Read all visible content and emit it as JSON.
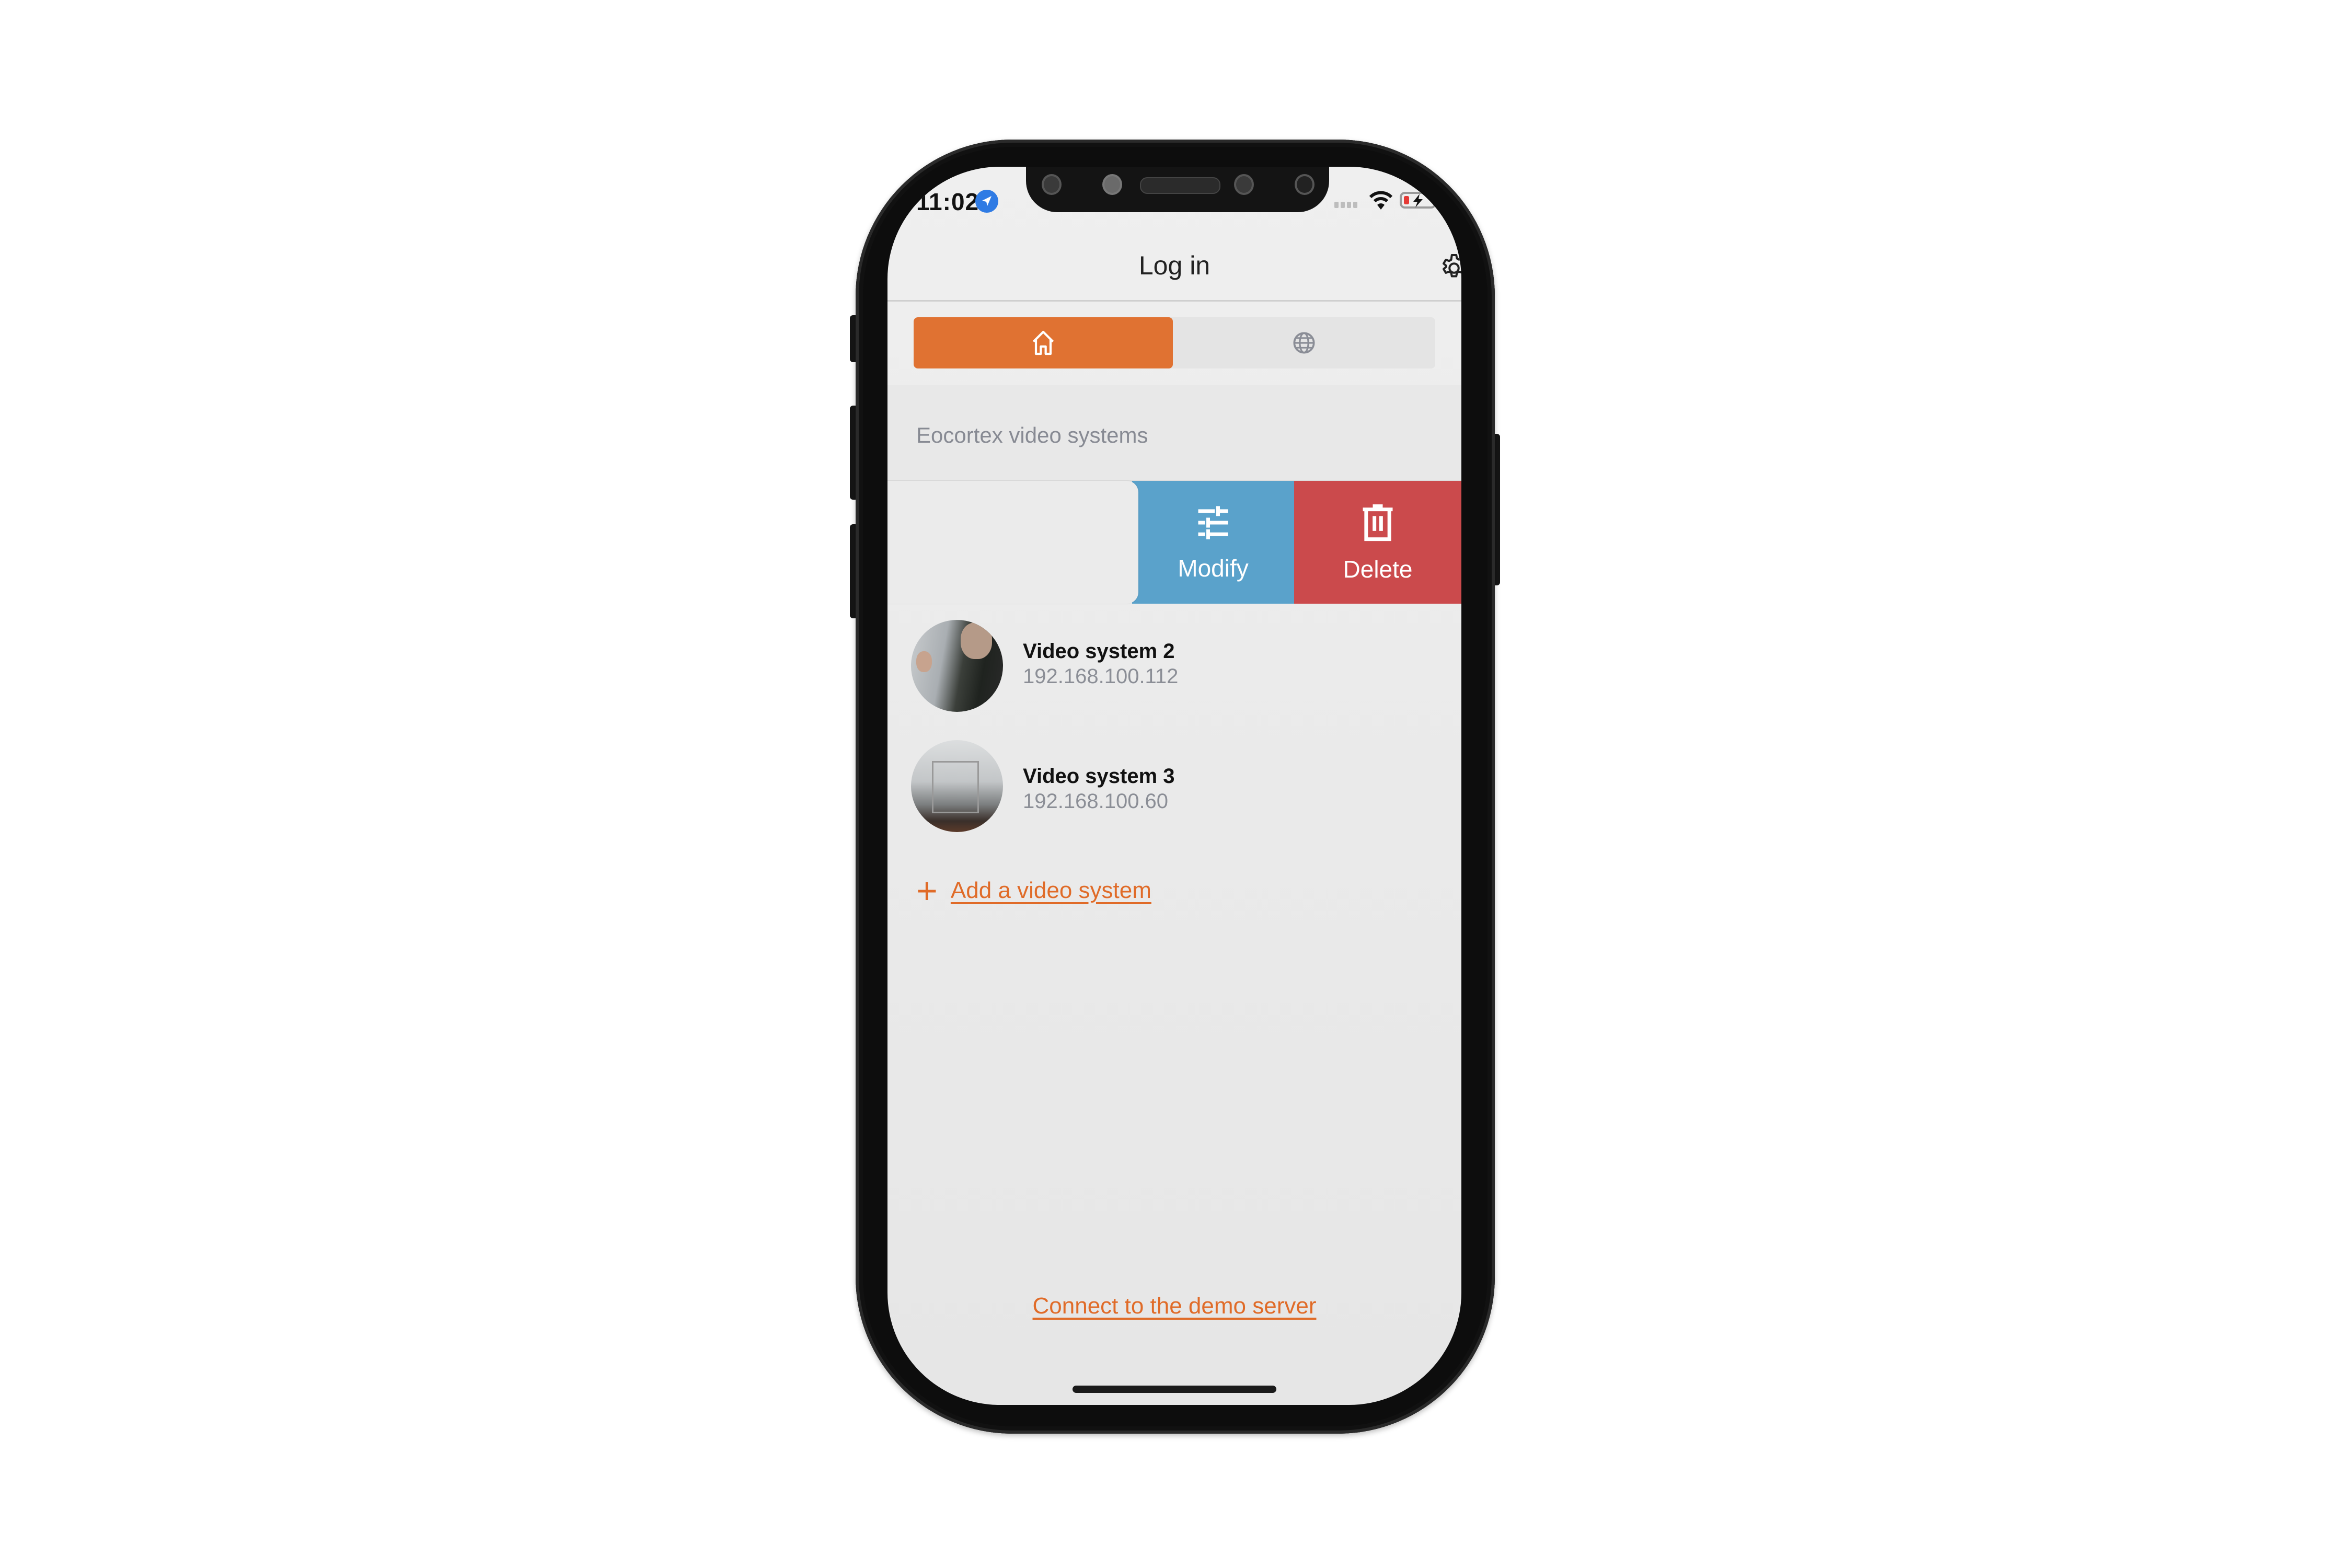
{
  "status_bar": {
    "time": "11:02",
    "location_icon": "location-arrow-icon",
    "signal_icon": "cellular-signal-icon",
    "wifi_icon": "wifi-icon",
    "battery_icon": "battery-charging-icon",
    "battery_level": "low"
  },
  "header": {
    "title": "Log in",
    "settings_icon": "gear-icon"
  },
  "segmented_control": {
    "tabs": [
      {
        "icon": "home-icon",
        "active": true
      },
      {
        "icon": "globe-icon",
        "active": false
      }
    ]
  },
  "section": {
    "title": "Eocortex video systems"
  },
  "swipe_actions": [
    {
      "label": "Modify",
      "icon": "sliders-icon",
      "color": "#5aa2cb"
    },
    {
      "label": "Delete",
      "icon": "trash-icon",
      "color": "#cb4a4c"
    }
  ],
  "video_systems": [
    {
      "name": "Video system 2",
      "address": "192.168.100.112"
    },
    {
      "name": "Video system 3",
      "address": "192.168.100.60"
    }
  ],
  "add_link": {
    "icon": "plus-icon",
    "label": "Add a video system"
  },
  "demo_link": {
    "label": "Connect to the demo server"
  },
  "colors": {
    "accent": "#e07232",
    "modify": "#5aa2cb",
    "delete": "#cb4a4c",
    "secondary_text": "#878a93"
  }
}
